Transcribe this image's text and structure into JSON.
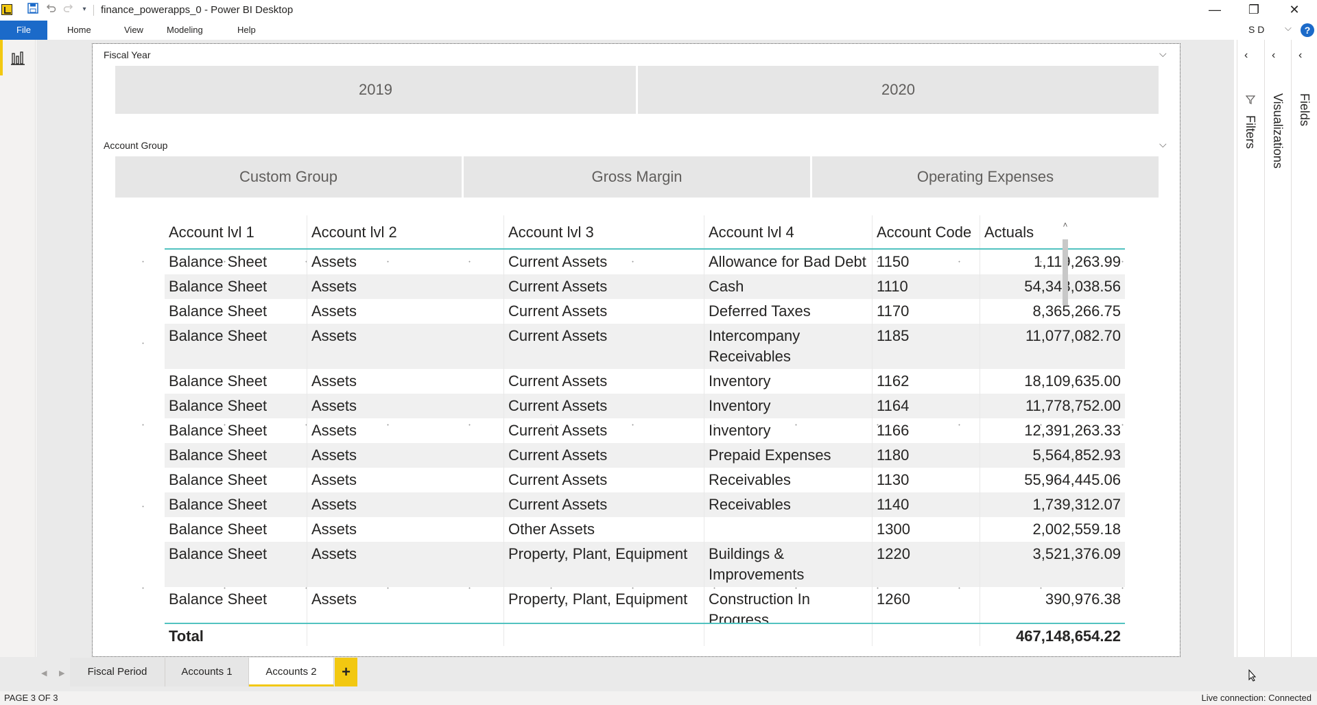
{
  "window": {
    "title": "finance_powerapps_0 - Power BI Desktop",
    "minimize": "—",
    "restore": "❐",
    "close": "✕"
  },
  "quick_access": {
    "save_icon": "save-icon",
    "undo_icon": "undo-icon",
    "redo_icon": "redo-icon",
    "more_icon": "chevron-down-icon"
  },
  "ribbon": {
    "file": "File",
    "tabs": [
      "Home",
      "View",
      "Modeling",
      "Help"
    ],
    "user": "S D",
    "help": "?"
  },
  "slicers": {
    "fiscal_year": {
      "title": "Fiscal Year",
      "options": [
        "2019",
        "2020"
      ]
    },
    "account_group": {
      "title": "Account Group",
      "options": [
        "Custom Group",
        "Gross Margin",
        "Operating Expenses"
      ]
    }
  },
  "table": {
    "headers": [
      "Account lvl 1",
      "Account lvl 2",
      "Account lvl 3",
      "Account lvl 4",
      "Account Code",
      "Actuals"
    ],
    "rows": [
      [
        "Balance Sheet",
        "Assets",
        "Current Assets",
        "Allowance for Bad Debt",
        "1150",
        "1,119,263.99"
      ],
      [
        "Balance Sheet",
        "Assets",
        "Current Assets",
        "Cash",
        "1110",
        "54,348,038.56"
      ],
      [
        "Balance Sheet",
        "Assets",
        "Current Assets",
        "Deferred Taxes",
        "1170",
        "8,365,266.75"
      ],
      [
        "Balance Sheet",
        "Assets",
        "Current Assets",
        "Intercompany Receivables",
        "1185",
        "11,077,082.70"
      ],
      [
        "Balance Sheet",
        "Assets",
        "Current Assets",
        "Inventory",
        "1162",
        "18,109,635.00"
      ],
      [
        "Balance Sheet",
        "Assets",
        "Current Assets",
        "Inventory",
        "1164",
        "11,778,752.00"
      ],
      [
        "Balance Sheet",
        "Assets",
        "Current Assets",
        "Inventory",
        "1166",
        "12,391,263.33"
      ],
      [
        "Balance Sheet",
        "Assets",
        "Current Assets",
        "Prepaid Expenses",
        "1180",
        "5,564,852.93"
      ],
      [
        "Balance Sheet",
        "Assets",
        "Current Assets",
        "Receivables",
        "1130",
        "55,964,445.06"
      ],
      [
        "Balance Sheet",
        "Assets",
        "Current Assets",
        "Receivables",
        "1140",
        "1,739,312.07"
      ],
      [
        "Balance Sheet",
        "Assets",
        "Other Assets",
        "",
        "1300",
        "2,002,559.18"
      ],
      [
        "Balance Sheet",
        "Assets",
        "Property, Plant, Equipment",
        "Buildings & Improvements",
        "1220",
        "3,521,376.09"
      ],
      [
        "Balance Sheet",
        "Assets",
        "Property, Plant, Equipment",
        "Construction In Progress",
        "1260",
        "390,976.38"
      ]
    ],
    "total_label": "Total",
    "total_value": "467,148,654.22"
  },
  "panes": {
    "filters": "Filters",
    "visualizations": "Visualizations",
    "fields": "Fields"
  },
  "pages": {
    "tabs": [
      "Fiscal Period",
      "Accounts 1",
      "Accounts 2"
    ],
    "active_index": 2,
    "add": "+"
  },
  "status": {
    "page": "PAGE 3 OF 3",
    "connection": "Live connection: Connected"
  }
}
